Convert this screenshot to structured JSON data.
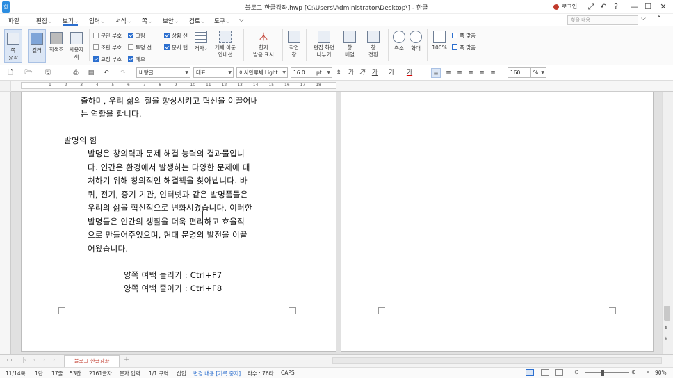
{
  "window": {
    "title": "블로그 한글강좌.hwp [C:\\Users\\Administrator\\Desktop\\] - 한글",
    "logo": "한",
    "login": "로그인",
    "controls": {
      "min": "—",
      "max": "☐",
      "close": "✕"
    }
  },
  "menu": {
    "items": [
      "파일",
      "편집",
      "보기",
      "입력",
      "서식",
      "쪽",
      "보안",
      "검토",
      "도구"
    ],
    "search_placeholder": "찾을 내용"
  },
  "ribbon": {
    "page_outline": "쪽\n윤곽",
    "color": "컬러",
    "gray": "회색조",
    "user_color": "사용자\n색",
    "checks": [
      {
        "label": "문단 부호",
        "checked": false
      },
      {
        "label": "조판 부호",
        "checked": false
      },
      {
        "label": "교정 부호",
        "checked": true
      },
      {
        "label": "그림",
        "checked": true
      },
      {
        "label": "투명 선",
        "checked": false
      },
      {
        "label": "메모",
        "checked": true
      },
      {
        "label": "상황 선",
        "checked": true
      },
      {
        "label": "문서 탭",
        "checked": true
      }
    ],
    "grid": "격자",
    "object_guide": "개체 이동\n안내선",
    "hanja": "한자\n발음 표시",
    "work_window": "작업\n창",
    "split": "편집 화면\n나누기",
    "window_arrange": "창\n배열",
    "window_switch": "창\n전환",
    "zoom_out": "축소",
    "zoom_in": "확대",
    "zoom_100": "100%",
    "fit_page": "쪽 맞춤",
    "fit_width": "폭 맞춤"
  },
  "format": {
    "style": "바탕글",
    "font_lang": "대표",
    "font": "이사만루체 Light",
    "size": "16.0",
    "unit": "pt",
    "spacing": "160",
    "spacing_unit": "%"
  },
  "ruler": {
    "numbers": [
      "1",
      "2",
      "3",
      "4",
      "5",
      "6",
      "7",
      "8",
      "9",
      "10",
      "11",
      "12",
      "13",
      "14",
      "15",
      "16",
      "17",
      "18"
    ]
  },
  "document": {
    "lines_top": [
      "출하며, 우리 삶의 질을 향상시키고 혁신을 이끌어내",
      "는 역할을 합니다."
    ],
    "heading": "발명의 힘",
    "body": [
      "발명은 창의력과 문제 해결 능력의 결과물입니",
      "다. 인간은 환경에서 발생하는 다양한 문제에 대",
      "처하기 위해 창의적인 해결책을 찾아냅니다. 바",
      "퀴, 전기, 증기 기관, 인터넷과 같은 발명품들은",
      "우리의 삶을 혁신적으로 변화시켰습니다. 이러한",
      "발명들은 인간의 생활을 더욱 편리하고 효율적",
      "으로 만들어주었으며, 현대 문명의 발전을 이끌",
      "어왔습니다."
    ],
    "shortcuts": [
      "양쪽 여백 늘리기 : Ctrl+F7",
      "양쪽 여백 줄이기 : Ctrl+F8"
    ]
  },
  "tabs": {
    "doc_tab": "블로그 한글강좌"
  },
  "status": {
    "page": "11/14쪽",
    "col": "1단",
    "line": "17줄",
    "cell": "53칸",
    "chars": "2161글자",
    "input_mode": "문자 입력",
    "section": "1/1 구역",
    "insert": "삽입",
    "track": "변경 내용 [기록 중지]",
    "typing": "타수 : 76타",
    "caps": "CAPS",
    "zoom": "90%"
  }
}
